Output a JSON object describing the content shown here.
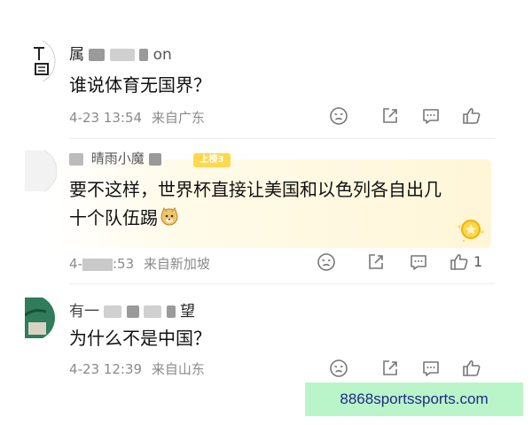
{
  "comments": [
    {
      "author_visible": "属",
      "author_tail": "on",
      "text": "谁说体育无国界？",
      "time": "4-23 13:54",
      "location": "来自广东",
      "like_count": ""
    },
    {
      "author_visible": "晴雨小魔",
      "badge": "上榜3",
      "text_line1": "要不这样，世界杯直接让美国和以色列各自出几",
      "text_line2": "十个队伍踢",
      "emoji": "doge",
      "time_prefix": "4-",
      "time_suffix": ":53",
      "location": "来自新加坡",
      "like_count": "1"
    },
    {
      "author_visible": "有一",
      "author_tail": "望",
      "text": "为什么不是中国？",
      "time": "4-23 12:39",
      "location": "来自山东",
      "like_count": ""
    }
  ],
  "icons": [
    "dislike-face-icon",
    "share-icon",
    "comment-icon",
    "like-thumb-icon"
  ],
  "watermark": "8868sportssports.com",
  "colors": {
    "meta": "#8a8a8a",
    "badge": "#ffd84d",
    "watermark_bg": "#b9f5c9",
    "watermark_text": "#1e2a8a"
  }
}
